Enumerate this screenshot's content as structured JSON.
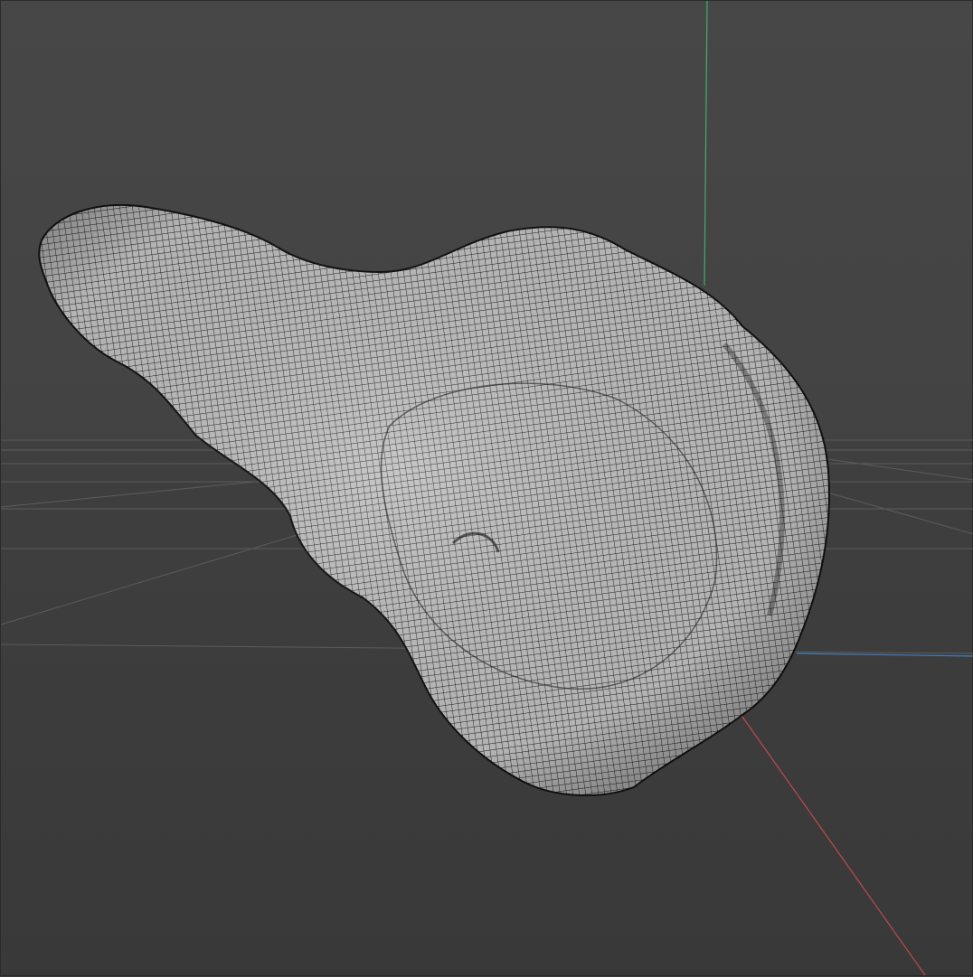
{
  "viewport": {
    "background_color": "#444444",
    "grid_color": "#5a5a5a",
    "axes": {
      "x_color": "#c24a4a",
      "y_color": "#3fae6a",
      "z_color": "#3f7fc4"
    },
    "mesh": {
      "fill_color": "#b9b9b9",
      "wire_color": "#1a1a1a",
      "display_mode": "wireframe-on-shaded"
    }
  }
}
